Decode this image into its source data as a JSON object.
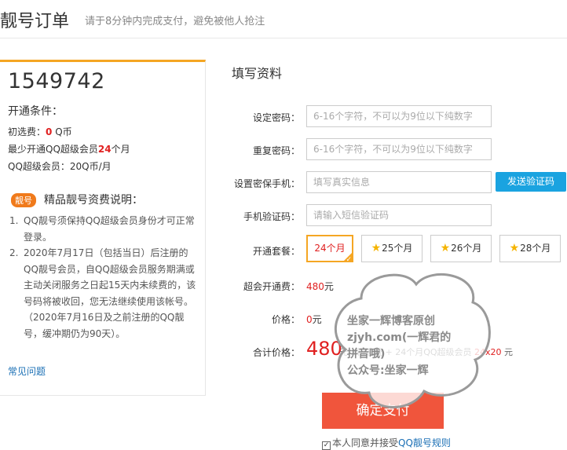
{
  "header": {
    "title": "靓号订单",
    "subtitle": "请于8分钟内完成支付，避免被他人抢注"
  },
  "left": {
    "number": "1549742",
    "conditions_title": "开通条件：",
    "initial_fee_label": "初选费：",
    "initial_fee_value": "0",
    "initial_fee_unit": "Q币",
    "min_member_label": "最少开通QQ超级会员",
    "min_member_value": "24",
    "min_member_unit": "个月",
    "member_price": "QQ超级会员：20Q币/月",
    "tag": "靓号",
    "fee_title": "精品靓号资费说明：",
    "notes": [
      {
        "n": "1.",
        "text": "QQ靓号须保持QQ超级会员身份才可正常登录。"
      },
      {
        "n": "2.",
        "text": "2020年7月17日（包括当日）后注册的QQ靓号会员，自QQ超级会员服务期满或主动关闭服务之日起15天内未续费的，该号码将被收回，您无法继续使用该帐号。（2020年7月16日及之前注册的QQ靓号，缓冲期仍为90天）。"
      }
    ],
    "faq": "常见问题"
  },
  "form": {
    "section_title": "填写资料",
    "password_label": "设定密码：",
    "password_placeholder": "6-16个字符，不可以为9位以下纯数字",
    "repeat_label": "重复密码：",
    "repeat_placeholder": "6-16个字符，不可以为9位以下纯数字",
    "phone_label": "设置密保手机：",
    "phone_placeholder": "填写真实信息",
    "send_code": "发送验证码",
    "code_label": "手机验证码：",
    "code_placeholder": "请输入短信验证码",
    "package_label": "开通套餐：",
    "packages": [
      "24个月",
      "25个月",
      "26个月",
      "28个月"
    ],
    "selected_package": "24个月",
    "member_fee_label": "超会开通费：",
    "member_fee_value": "480",
    "member_fee_unit": "元",
    "price_label": "价格：",
    "price_value": "0",
    "price_unit": "元",
    "total_label": "合计价格：",
    "total_value": "480",
    "total_detail_prefix": "元（初选费 + 24个月QQ超级会员",
    "total_detail_calc": "24x20",
    "total_detail_suffix": "元",
    "pay_button": "确定支付",
    "agree_text": "本人同意并接受",
    "agree_link": "QQ靓号规则"
  },
  "watermark": {
    "line1": "坐家一辉博客原创",
    "line2": "zjyh.com(一辉君的",
    "line3": "拼音哦)",
    "line4": "公众号:坐家一辉"
  },
  "colors": {
    "accent_orange": "#f5a623",
    "price_red": "#e02020",
    "pay_button": "#f0553c",
    "sms_button": "#1aa3e0",
    "link_blue": "#1a6fb5"
  }
}
